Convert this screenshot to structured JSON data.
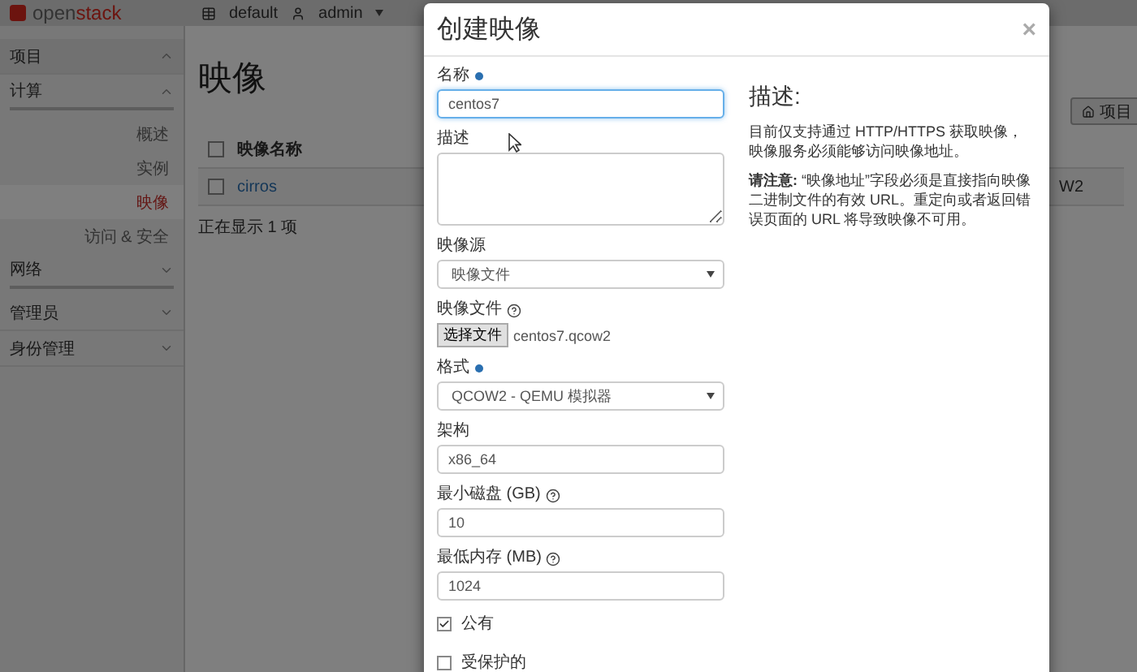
{
  "header": {
    "logo_parts": [
      "open",
      "stack"
    ],
    "project": "default",
    "user": "admin"
  },
  "sidebar": {
    "items": [
      {
        "label": "项目",
        "expanded": true,
        "children": [
          {
            "label": "计算",
            "expanded": true,
            "children": [
              {
                "label": "概述",
                "selected": false
              },
              {
                "label": "实例",
                "selected": false
              },
              {
                "label": "映像",
                "selected": true
              },
              {
                "label": "访问 & 安全",
                "selected": false
              }
            ]
          },
          {
            "label": "网络",
            "expanded": false
          }
        ]
      },
      {
        "label": "管理员",
        "expanded": false
      },
      {
        "label": "身份管理",
        "expanded": false
      }
    ]
  },
  "main": {
    "title": "映像",
    "action_button": "项目",
    "table": {
      "columns": [
        {
          "label": "映像名称"
        }
      ],
      "header_checked": false,
      "rows": [
        {
          "selected": false,
          "name": "cirros",
          "column_3": "W2"
        }
      ],
      "footer": "正在显示 1 项"
    }
  },
  "dialog": {
    "title": "创建映像",
    "close": "×",
    "fields": [
      {
        "kind": "text",
        "label": "名称",
        "required": true,
        "help": false,
        "focused": true,
        "value": "centos7"
      },
      {
        "kind": "textarea",
        "label": "描述",
        "required": false,
        "help": false,
        "focused": false
      },
      {
        "kind": "select",
        "label": "映像源",
        "required": false,
        "help": false,
        "focused": false,
        "value": "映像文件"
      },
      {
        "kind": "file",
        "label": "映像文件",
        "required": false,
        "help": true,
        "button": "选择文件",
        "value": "centos7.qcow2"
      },
      {
        "kind": "select",
        "label": "格式",
        "required": true,
        "help": false,
        "focused": false,
        "value": "QCOW2 - QEMU 模拟器"
      },
      {
        "kind": "text",
        "label": "架构",
        "required": false,
        "help": false,
        "focused": false,
        "value": "x86_64"
      },
      {
        "kind": "text",
        "label": "最小磁盘 (GB)",
        "required": false,
        "help": true,
        "focused": false,
        "value": "10"
      },
      {
        "kind": "text",
        "label": "最低内存 (MB)",
        "required": false,
        "help": true,
        "focused": false,
        "value": "1024"
      },
      {
        "kind": "checkbox",
        "label": "公有",
        "checked": true
      },
      {
        "kind": "checkbox",
        "label": "受保护的",
        "checked": false
      }
    ],
    "description": {
      "heading": "描述:",
      "paragraphs": [
        "目前仅支持通过 HTTP/HTTPS 获取映像，映像服务必须能够访问映像地址。",
        "**请注意:** “映像地址”字段必须是直接指向映像二进制文件的有效 URL。重定向或者返回错误页面的 URL 将导致映像不可用。"
      ]
    }
  }
}
